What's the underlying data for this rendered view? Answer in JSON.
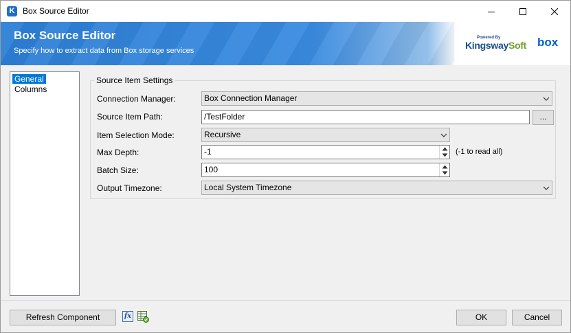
{
  "window": {
    "title": "Box Source Editor"
  },
  "banner": {
    "title": "Box Source Editor",
    "subtitle": "Specify how to extract data from Box storage services",
    "kingsway_powered": "Powered By",
    "kingsway_name_part1": "Kingsway",
    "kingsway_name_part2": "Soft",
    "box_logo": "box",
    "colors": {
      "banner_blue": "#2d7fd5",
      "box_blue": "#0061d5",
      "kingsway_green": "#6fa02a"
    }
  },
  "nav": {
    "items": [
      {
        "label": "General",
        "selected": true
      },
      {
        "label": "Columns",
        "selected": false
      }
    ]
  },
  "settings": {
    "group_title": "Source Item Settings",
    "connection_manager": {
      "label": "Connection Manager:",
      "value": "Box Connection Manager"
    },
    "source_item_path": {
      "label": "Source Item Path:",
      "value": "/TestFolder",
      "browse_label": "..."
    },
    "item_selection_mode": {
      "label": "Item Selection Mode:",
      "value": "Recursive"
    },
    "max_depth": {
      "label": "Max Depth:",
      "value": "-1",
      "hint": "(-1 to read all)"
    },
    "batch_size": {
      "label": "Batch Size:",
      "value": "100"
    },
    "output_timezone": {
      "label": "Output Timezone:",
      "value": "Local System Timezone"
    }
  },
  "footer": {
    "refresh_label": "Refresh Component",
    "fx_label": "fx",
    "ok_label": "OK",
    "cancel_label": "Cancel"
  }
}
